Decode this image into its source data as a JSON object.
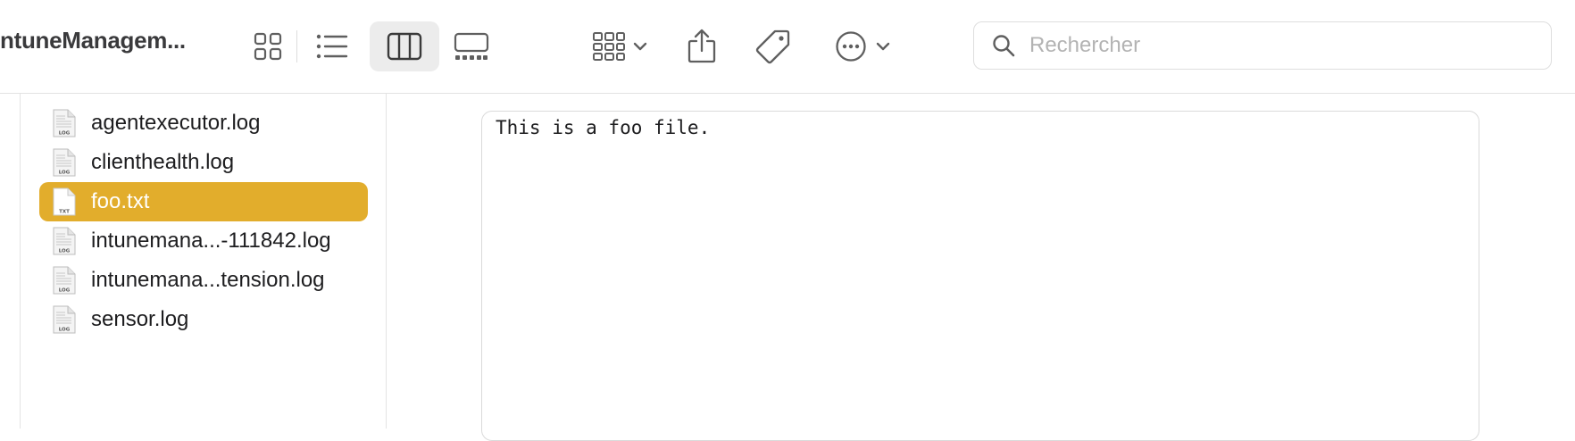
{
  "window": {
    "title": "ntuneManagem..."
  },
  "toolbar": {
    "view_icons": "icon-grid-view-icon",
    "view_list": "list-view-icon",
    "view_columns": "column-view-icon",
    "view_gallery": "gallery-view-icon",
    "group": "group-by-icon",
    "share": "share-icon",
    "tags": "tag-icon",
    "more": "more-actions-icon",
    "active_view": "columns"
  },
  "search": {
    "placeholder": "Rechercher",
    "value": ""
  },
  "files": [
    {
      "name": "agentexecutor.log",
      "badge": "LOG",
      "selected": false
    },
    {
      "name": "clienthealth.log",
      "badge": "LOG",
      "selected": false
    },
    {
      "name": "foo.txt",
      "badge": "TXT",
      "selected": true
    },
    {
      "name": "intunemana...-111842.log",
      "badge": "LOG",
      "selected": false
    },
    {
      "name": "intunemana...tension.log",
      "badge": "LOG",
      "selected": false
    },
    {
      "name": "sensor.log",
      "badge": "LOG",
      "selected": false
    }
  ],
  "preview": {
    "content": "This is a foo file."
  },
  "colors": {
    "selection": "#e2ad2c",
    "active_toggle": "#ececec"
  }
}
